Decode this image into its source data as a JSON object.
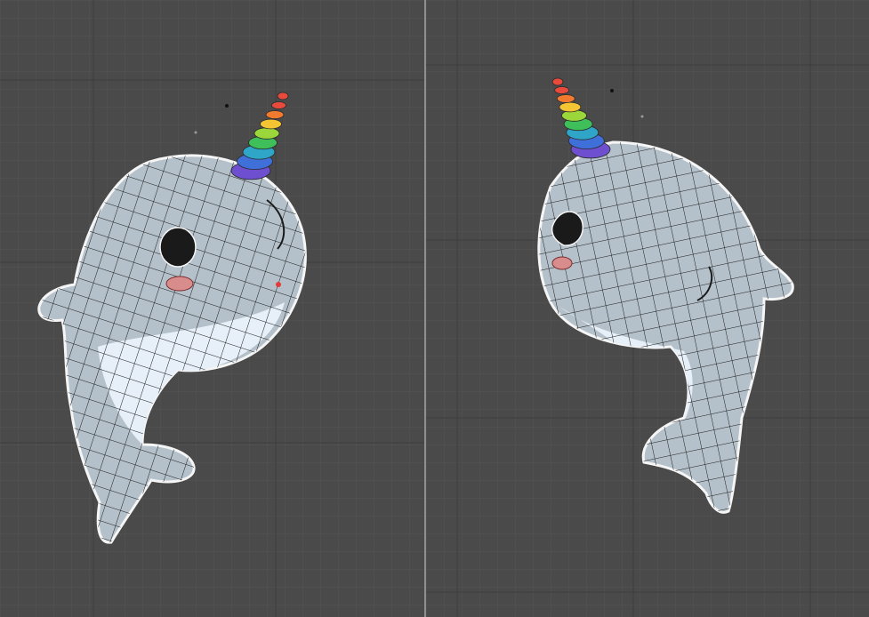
{
  "app": {
    "title": ""
  },
  "colors": {
    "background": "#4a4a4a",
    "grid_minor": "#535353",
    "grid_major": "#3c3c3c",
    "body": "#b4c1ca",
    "belly": "#e7f0f8",
    "wire": "#1b1b1b",
    "outline": "#f5f5f5",
    "cheek": "#d98c8c",
    "eye": "#1a1a1a",
    "horn": [
      "#e84b3c",
      "#f07b2f",
      "#f3c433",
      "#9bd63a",
      "#3fbf5a",
      "#2fa6c7",
      "#3f6fd8",
      "#6d4fd0"
    ]
  },
  "viewports": [
    {
      "name": "front-view",
      "label": ""
    },
    {
      "name": "side-view",
      "label": ""
    }
  ],
  "icons": {
    "selection_dot": "small-vertex-dot",
    "horn": "rainbow-spiral-horn"
  }
}
